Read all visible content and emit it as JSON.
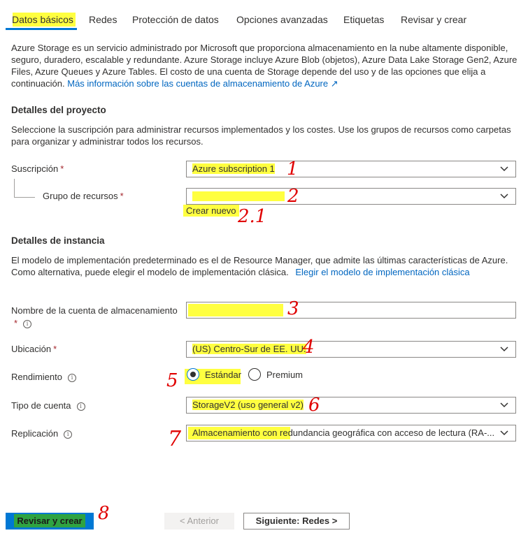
{
  "tabs": [
    {
      "label": "Datos básicos"
    },
    {
      "label": "Redes"
    },
    {
      "label": "Protección de datos"
    },
    {
      "label": "Opciones avanzadas"
    },
    {
      "label": "Etiquetas"
    },
    {
      "label": "Revisar y crear"
    }
  ],
  "intro": {
    "text": "Azure Storage es un servicio administrado por Microsoft que proporciona almacenamiento en la nube altamente disponible, seguro, duradero, escalable y redundante. Azure Storage incluye Azure Blob (objetos), Azure Data Lake Storage Gen2, Azure Files, Azure Queues y Azure Tables. El costo de una cuenta de Storage depende del uso y de las opciones que elija a continuación.",
    "link": "Más información sobre las cuentas de almacenamiento de Azure"
  },
  "project": {
    "heading": "Detalles del proyecto",
    "description": "Seleccione la suscripción para administrar recursos implementados y los costes. Use los grupos de recursos como carpetas para organizar y administrar todos los recursos.",
    "subscription_label": "Suscripción",
    "subscription_value": "Azure subscription 1",
    "resource_group_label": "Grupo de recursos",
    "resource_group_value": "",
    "create_new": "Crear nuevo"
  },
  "instance": {
    "heading": "Detalles de instancia",
    "description": "El modelo de implementación predeterminado es el de Resource Manager, que admite las últimas características de Azure. Como alternativa, puede elegir el modelo de implementación clásica.",
    "classic_link": "Elegir el modelo de implementación clásica",
    "account_name_label": "Nombre de la cuenta de almacenamiento",
    "account_name_value": "",
    "location_label": "Ubicación",
    "location_value": "(US) Centro-Sur de EE. UU.",
    "performance_label": "Rendimiento",
    "performance_standard": "Estándar",
    "performance_premium": "Premium",
    "account_type_label": "Tipo de cuenta",
    "account_type_value": "StorageV2 (uso general v2)",
    "replication_label": "Replicación",
    "replication_value": "Almacenamiento con redundancia geográfica con acceso de lectura (RA-..."
  },
  "required_mark": "*",
  "annotations": [
    "1",
    "2",
    "2.1",
    "3",
    "4",
    "5",
    "6",
    "7",
    "8"
  ],
  "footer": {
    "review_create": "Revisar y crear",
    "previous": "< Anterior",
    "next": "Siguiente: Redes >"
  },
  "colors": {
    "accent": "#0078d4",
    "highlight": "#ffff40",
    "annotation": "#e00000",
    "required": "#a4262c"
  }
}
